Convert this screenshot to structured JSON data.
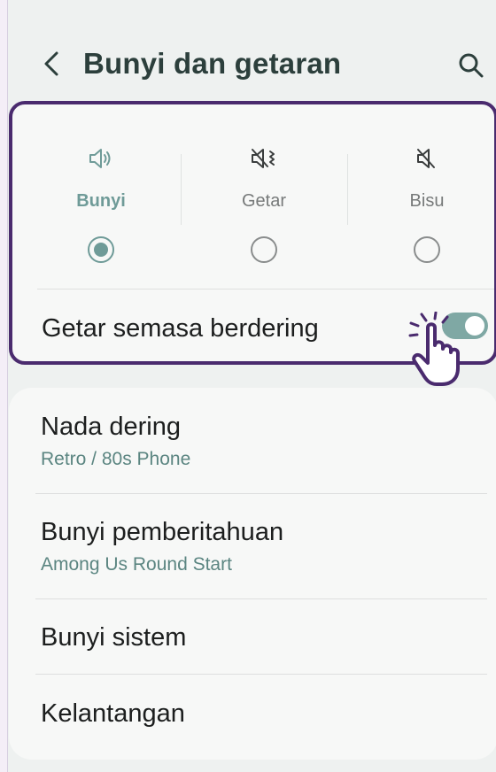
{
  "header": {
    "title": "Bunyi dan getaran",
    "back_icon": "back-chevron-icon",
    "search_icon": "search-icon"
  },
  "sound_mode": {
    "options": [
      {
        "label": "Bunyi",
        "icon": "speaker-icon",
        "selected": true
      },
      {
        "label": "Getar",
        "icon": "vibrate-icon",
        "selected": false
      },
      {
        "label": "Bisu",
        "icon": "mute-icon",
        "selected": false
      }
    ],
    "vibrate_while_ringing": {
      "label": "Getar semasa berdering",
      "enabled": true
    }
  },
  "settings": [
    {
      "title": "Nada dering",
      "subtitle": "Retro / 80s Phone"
    },
    {
      "title": "Bunyi pemberitahuan",
      "subtitle": "Among Us Round Start"
    },
    {
      "title": "Bunyi sistem"
    },
    {
      "title": "Kelantangan"
    }
  ],
  "colors": {
    "accent": "#6f9b98",
    "highlight_border": "#4a2b6e",
    "background": "#eef1f0"
  }
}
